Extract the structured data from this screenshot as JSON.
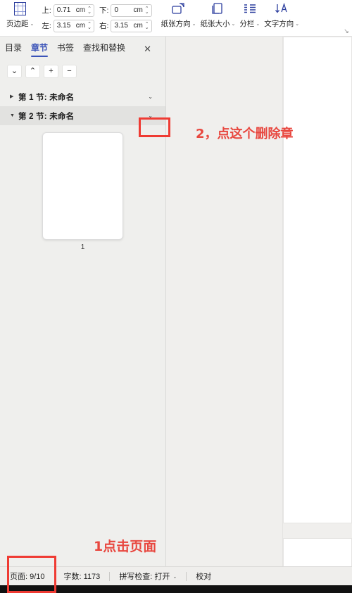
{
  "ribbon": {
    "margins": {
      "icon": "page-margins-icon",
      "label": "页边距",
      "caret": "⌄"
    },
    "fields": [
      {
        "name": "top",
        "label": "上:",
        "value": "0.71",
        "unit": "cm"
      },
      {
        "name": "bottom",
        "label": "下:",
        "value": "0",
        "unit": "cm"
      },
      {
        "name": "left",
        "label": "左:",
        "value": "3.15",
        "unit": "cm"
      },
      {
        "name": "right",
        "label": "右:",
        "value": "3.15",
        "unit": "cm"
      }
    ],
    "buttons": [
      {
        "name": "page-orientation",
        "icon": "page-orientation-icon",
        "label": "纸张方向",
        "caret": "⌄"
      },
      {
        "name": "page-size",
        "icon": "page-size-icon",
        "label": "纸张大小",
        "caret": "⌄"
      },
      {
        "name": "columns",
        "icon": "columns-icon",
        "label": "分栏",
        "caret": "⌄"
      },
      {
        "name": "text-direction",
        "icon": "text-direction-icon",
        "label": "文字方向",
        "caret": "⌄"
      }
    ],
    "dialog_launcher": "⌐"
  },
  "navpanel": {
    "tabs": [
      {
        "label": "目录",
        "active": false
      },
      {
        "label": "章节",
        "active": true
      },
      {
        "label": "书签",
        "active": false
      },
      {
        "label": "查找和替换",
        "active": false
      }
    ],
    "close_label": "✕",
    "toolbar": [
      {
        "name": "move-down-button",
        "glyph": "⌄"
      },
      {
        "name": "move-up-button",
        "glyph": "⌃"
      },
      {
        "name": "add-button",
        "glyph": "+"
      },
      {
        "name": "remove-button",
        "glyph": "−"
      }
    ],
    "sections": [
      {
        "label": "第 1 节: 未命名",
        "triangle": "▶",
        "chevron": "⌄",
        "selected": false
      },
      {
        "label": "第 2 节: 未命名",
        "triangle": "▼",
        "chevron": "⌄",
        "selected": true
      }
    ],
    "thumbnail": {
      "page_number": "1"
    }
  },
  "statusbar": {
    "items": [
      {
        "name": "page-count",
        "text": "页面: 9/10"
      },
      {
        "name": "word-count",
        "text": "字数: 1173"
      },
      {
        "name": "spell-check",
        "text": "拼写检查: 打开",
        "caret": "⌄"
      },
      {
        "name": "proofread",
        "text": "校对"
      }
    ]
  },
  "annotations": {
    "step2": "2，点这个删除章",
    "step1": "1点击页面"
  },
  "colors": {
    "accent_blue": "#3b53b8",
    "annotation_red": "#ef3b33",
    "panel_bg": "#efefed",
    "canvas_bg": "#f0efed"
  }
}
